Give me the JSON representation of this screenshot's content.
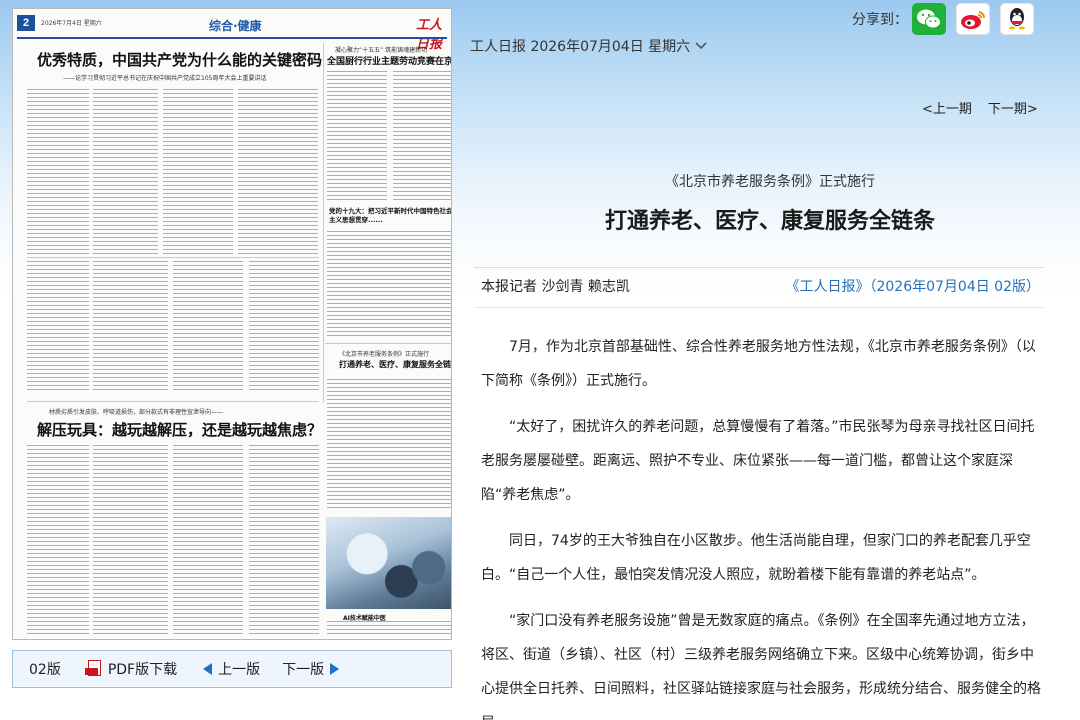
{
  "paper": {
    "page_number": "2",
    "date_line": "2026年7月4日  星期六",
    "section": "综合·健康",
    "logo_text": "工人日报",
    "lead_headline": "优秀特质，中国共产党为什么能的关键密码",
    "lead_subtitle": "——论学习贯彻习近平总书记在庆祝中国共产党成立105周年大会上重要讲话",
    "right_headline": "全国厨行行业主题劳动竞赛在京启动",
    "right_kicker": "凝心聚力“十五五” 筑能铸魂建新功",
    "mid_headline": "党的十九大：把习近平新时代中国特色社会主义思想贯穿......",
    "article_kicker_small": "《北京市养老服务条例》正式施行",
    "article_headline_small": "打通养老、医疗、康复服务全链条",
    "lower_kicker": "材质劣质引发皮肤、呼吸道损伤，部分款式有非理性宣泄导向——",
    "lower_headline": "解压玩具：越玩越解压，还是越玩越焦虑？",
    "photo_caption": "AI技术赋能中医"
  },
  "paper_nav": {
    "page_label": "02版",
    "pdf_label": "PDF版下载",
    "prev_label": "上一版",
    "next_label": "下一版"
  },
  "share": {
    "label": "分享到：",
    "buttons": [
      "wechat-icon",
      "weibo-icon",
      "qq-icon"
    ]
  },
  "issue": {
    "selector_label": "工人日报 2026年07月04日 星期六",
    "prev_issue": "<上一期",
    "next_issue": "下一期>"
  },
  "article": {
    "kicker": "《北京市养老服务条例》正式施行",
    "title": "打通养老、医疗、康复服务全链条",
    "author": "本报记者 沙剑青 赖志凯",
    "source": "《工人日报》（2026年07月04日 02版）",
    "paragraphs": [
      "7月，作为北京首部基础性、综合性养老服务地方性法规，《北京市养老服务条例》（以下简称《条例》）正式施行。",
      "“太好了，困扰许久的养老问题，总算慢慢有了着落。”市民张琴为母亲寻找社区日间托老服务屡屡碰壁。距离远、照护不专业、床位紧张——每一道门槛，都曾让这个家庭深陷“养老焦虑”。",
      "同日，74岁的王大爷独自在小区散步。他生活尚能自理，但家门口的养老配套几乎空白。“自己一个人住，最怕突发情况没人照应，就盼着楼下能有靠谱的养老站点”。",
      "“家门口没有养老服务设施”曾是无数家庭的痛点。《条例》在全国率先通过地方立法，将区、街道（乡镇）、社区（村）三级养老服务网络确立下来。区级中心统筹协调，街乡中心提供全日托养、日间照料，社区驿站链接家庭与社会服务，形成统分结合、服务健全的格局。"
    ]
  },
  "colors": {
    "accent_blue": "#2a6fb8",
    "paper_red": "#c8161e",
    "wechat_green": "#20b13a"
  }
}
